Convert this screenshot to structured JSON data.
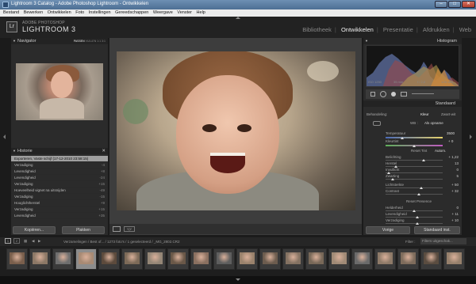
{
  "window": {
    "title": "Lightroom 3 Catalog - Adobe Photoshop Lightroom - Ontwikkelen",
    "min": "–",
    "max": "□",
    "close": "✕"
  },
  "menu": [
    "Bestand",
    "Bewerken",
    "Ontwikkelen",
    "Foto",
    "Instellingen",
    "Gereedschappen",
    "Weergave",
    "Venster",
    "Help"
  ],
  "identity": {
    "logo": "Lr",
    "line1": "ADOBE PHOTOSHOP",
    "line2": "LIGHTROOM 3"
  },
  "modules": [
    {
      "label": "Bibliotheek",
      "active": false
    },
    {
      "label": "Ontwikkelen",
      "active": true
    },
    {
      "label": "Presentatie",
      "active": false
    },
    {
      "label": "Afdrukken",
      "active": false
    },
    {
      "label": "Web",
      "active": false
    }
  ],
  "navigator": {
    "title": "Navigator",
    "tabs": [
      "PASSEN",
      "VULLEN",
      "1:1",
      "3:1"
    ]
  },
  "history": {
    "title": "Historie",
    "items": [
      {
        "label": "Exporteren, Vaste schijf (17-12-2010 23:58:15)",
        "value": "",
        "selected": true
      },
      {
        "label": "Verzadiging",
        "value": "-4"
      },
      {
        "label": "Levendigheid",
        "value": "+8"
      },
      {
        "label": "Levendigheid",
        "value": "-24"
      },
      {
        "label": "Verzadiging",
        "value": "+15"
      },
      {
        "label": "Hoeveelheid vignet na uitsnijden",
        "value": "-49"
      },
      {
        "label": "Verzadiging",
        "value": "-15"
      },
      {
        "label": "Hooglichtherstel",
        "value": "+9"
      },
      {
        "label": "Verzadiging",
        "value": "+15"
      },
      {
        "label": "Levendigheid",
        "value": "+35"
      }
    ]
  },
  "left_buttons": {
    "copy": "Kopiëren...",
    "paste": "Plakken"
  },
  "histogram": {
    "title": "Histogram",
    "iso": "ISO 1250",
    "focal": "35 mm",
    "aperture": "f / 2,8",
    "shutter": "1/30 sec"
  },
  "preset": "Standaard",
  "basic": {
    "process_label": "Behandeling:",
    "color": "Kleur",
    "bw": "Zwart-wit",
    "wb_label": "WB :",
    "wb_value": "Als opname",
    "temp_label": "Temperatuur",
    "temp_value": "3500",
    "tint_label": "Kleurtint",
    "tint_value": "+ 0",
    "tone_header": "Reset Tint",
    "auto": "Autom.",
    "tone_rows": [
      {
        "label": "Belichting",
        "value": "+ 1,22",
        "pos": 0.66
      },
      {
        "label": "Herstel",
        "value": "13",
        "pos": 0.18
      },
      {
        "label": "Invullicht",
        "value": "0",
        "pos": 0.05
      },
      {
        "label": "Zwarting",
        "value": "5",
        "pos": 0.12
      }
    ],
    "bc_rows": [
      {
        "label": "Lichtsterkte",
        "value": "+ 50",
        "pos": 0.62
      },
      {
        "label": "Contrast",
        "value": "+ 32",
        "pos": 0.58
      }
    ],
    "presence_header": "Reset Presence",
    "presence_rows": [
      {
        "label": "Helderheid",
        "value": "0",
        "pos": 0.5
      },
      {
        "label": "Levendigheid",
        "value": "+ 11",
        "pos": 0.56
      },
      {
        "label": "Verzadiging",
        "value": "+ 10",
        "pos": 0.55
      }
    ]
  },
  "right_buttons": {
    "prev": "Vorige",
    "reset": "Standaard inst."
  },
  "filmstrip": {
    "source": "Verzamelingen / Best of... / 1273 foto's / 1 geselecteerd / _MG_2802.CR2",
    "filter_label": "Filter :",
    "filter_value": "Filters uitgeschak...",
    "page_numbers": [
      "1",
      "2"
    ]
  },
  "colors": {
    "accent": "#e0e0e0",
    "panel": "#2b2b2b",
    "selected_row": "#9f9f9f"
  }
}
